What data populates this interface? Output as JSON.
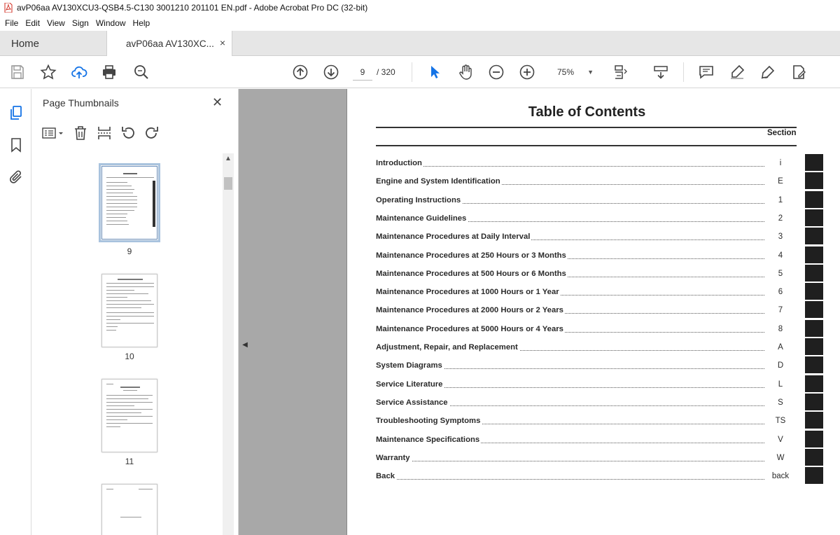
{
  "window": {
    "title": "avP06aa AV130XCU3-QSB4.5-C130 3001210 201101 EN.pdf - Adobe Acrobat Pro DC (32-bit)"
  },
  "menu": [
    "File",
    "Edit",
    "View",
    "Sign",
    "Window",
    "Help"
  ],
  "tabs": {
    "home": "Home",
    "document": "avP06aa AV130XC...",
    "close": "×"
  },
  "toolbar": {
    "current_page": "9",
    "page_total": "/ 320",
    "zoom": "75%"
  },
  "panel": {
    "title": "Page Thumbnails",
    "close": "✕",
    "thumbnails": [
      {
        "label": "9",
        "selected": true
      },
      {
        "label": "10",
        "selected": false
      },
      {
        "label": "11",
        "selected": false
      }
    ]
  },
  "document": {
    "title": "Table of Contents",
    "section_header": "Section",
    "entries": [
      {
        "label": "Introduction",
        "section": "i"
      },
      {
        "label": "Engine and System Identification",
        "section": "E"
      },
      {
        "label": "Operating Instructions",
        "section": "1"
      },
      {
        "label": "Maintenance Guidelines",
        "section": "2"
      },
      {
        "label": "Maintenance Procedures at Daily Interval",
        "section": "3"
      },
      {
        "label": "Maintenance Procedures at 250 Hours or 3 Months",
        "section": "4"
      },
      {
        "label": "Maintenance Procedures at 500 Hours or 6 Months",
        "section": "5"
      },
      {
        "label": "Maintenance Procedures at 1000 Hours or 1 Year",
        "section": "6"
      },
      {
        "label": "Maintenance Procedures at 2000 Hours or 2 Years",
        "section": "7"
      },
      {
        "label": "Maintenance Procedures at 5000 Hours or 4 Years",
        "section": "8"
      },
      {
        "label": "Adjustment, Repair, and Replacement",
        "section": "A"
      },
      {
        "label": "System Diagrams",
        "section": "D"
      },
      {
        "label": "Service Literature",
        "section": "L"
      },
      {
        "label": "Service Assistance",
        "section": "S"
      },
      {
        "label": "Troubleshooting Symptoms",
        "section": "TS"
      },
      {
        "label": "Maintenance Specifications",
        "section": "V"
      },
      {
        "label": "Warranty",
        "section": "W"
      },
      {
        "label": "Back",
        "section": "back"
      }
    ]
  },
  "colors": {
    "accent": "#1473e6",
    "tab_bar": "#e6e6e6",
    "doc_background": "#a8a8a8",
    "thumb_selected": "#a9c3de"
  }
}
